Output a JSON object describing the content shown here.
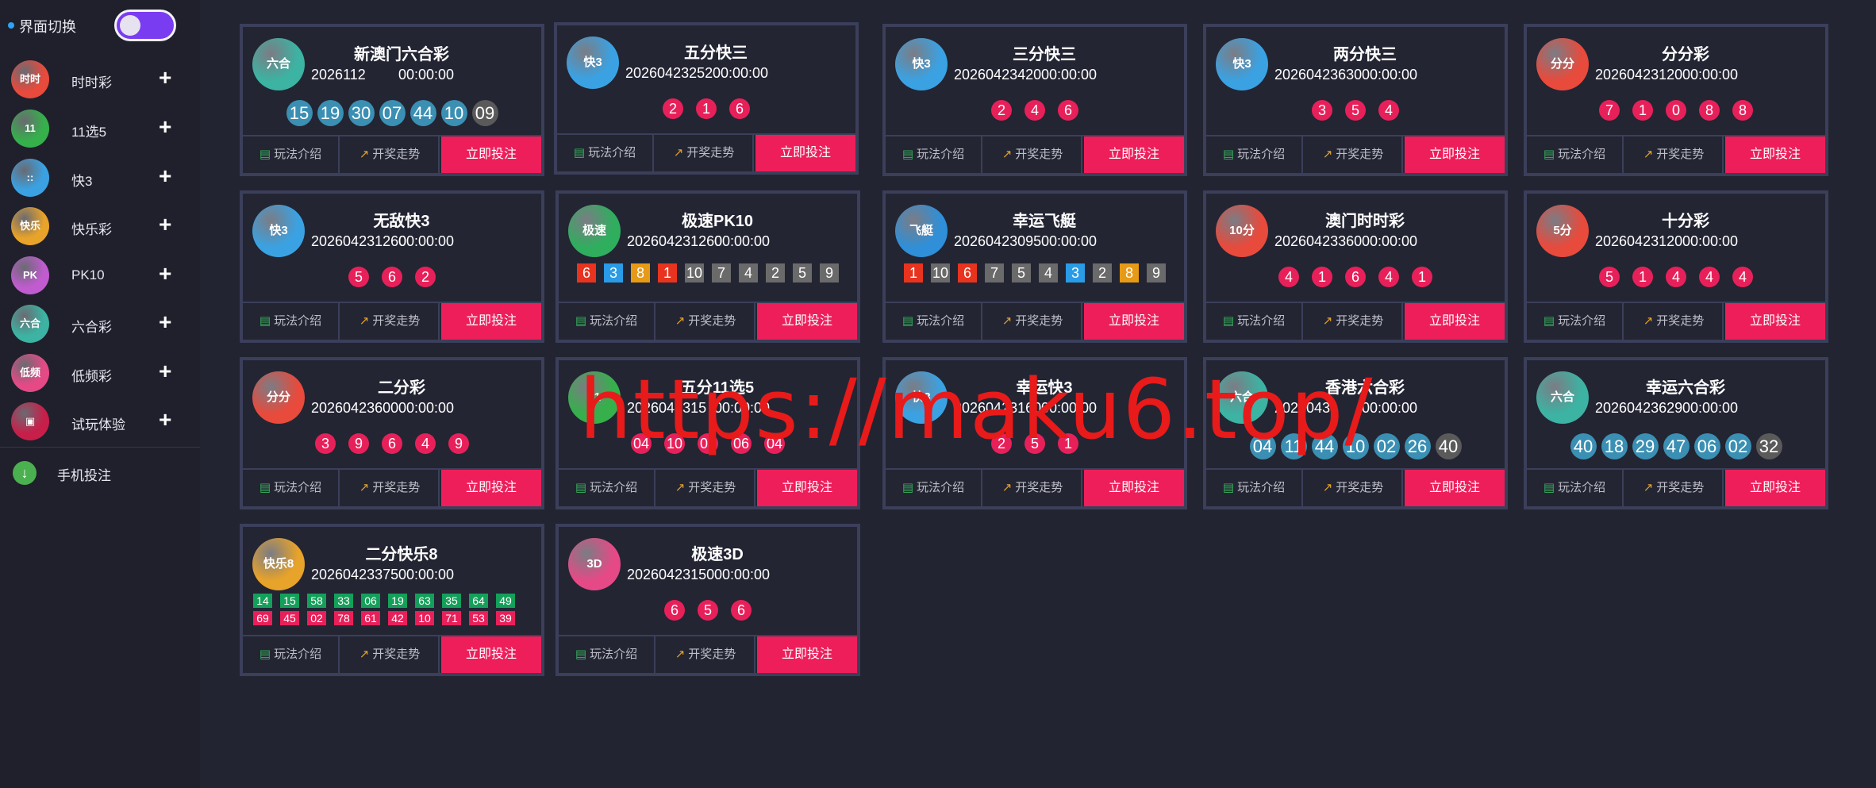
{
  "sidebar": {
    "switch_label": "界面切换",
    "items": [
      {
        "label": "时时彩",
        "icon_text": "时时",
        "icon_color": "#e84a3c"
      },
      {
        "label": "11选5",
        "icon_text": "11",
        "icon_color": "#35b04b"
      },
      {
        "label": "快3",
        "icon_text": "::",
        "icon_color": "#3aa2e3"
      },
      {
        "label": "快乐彩",
        "icon_text": "快乐",
        "icon_color": "#e8a32a"
      },
      {
        "label": "PK10",
        "icon_text": "PK",
        "icon_color": "#c05ccf"
      },
      {
        "label": "六合彩",
        "icon_text": "六合",
        "icon_color": "#3cb3a3"
      },
      {
        "label": "低频彩",
        "icon_text": "低频",
        "icon_color": "#e54a86"
      },
      {
        "label": "试玩体验",
        "icon_text": "▣",
        "icon_color": "#c81e4a"
      }
    ],
    "mobile_label": "手机投注"
  },
  "labels": {
    "rules": "玩法介绍",
    "trend": "开奖走势",
    "bet": "立即投注"
  },
  "cards": [
    {
      "title": "新澳门六合彩",
      "period": "2026112",
      "countdown": "00:00:00",
      "icon_text": "六合",
      "icon_color": "#3cb3a3",
      "type": "blue",
      "balls": [
        "15",
        "19",
        "30",
        "07",
        "44",
        "10",
        "09"
      ]
    },
    {
      "title": "五分快三",
      "period": "20260423252",
      "countdown": "00:00:00",
      "icon_text": "快3",
      "icon_color": "#3aa2e3",
      "type": "red",
      "balls": [
        "2",
        "1",
        "6"
      ]
    },
    {
      "title": "三分快三",
      "period": "20260423420",
      "countdown": "00:00:00",
      "icon_text": "快3",
      "icon_color": "#3aa2e3",
      "type": "red",
      "balls": [
        "2",
        "4",
        "6"
      ]
    },
    {
      "title": "两分快三",
      "period": "20260423630",
      "countdown": "00:00:00",
      "icon_text": "快3",
      "icon_color": "#3aa2e3",
      "type": "red",
      "balls": [
        "3",
        "5",
        "4"
      ]
    },
    {
      "title": "分分彩",
      "period": "20260423120",
      "countdown": "00:00:00",
      "icon_text": "分分",
      "icon_color": "#e84a3c",
      "type": "red",
      "balls": [
        "7",
        "1",
        "0",
        "8",
        "8"
      ]
    },
    {
      "title": "无敌快3",
      "period": "202604231260",
      "countdown": "00:00:00",
      "icon_text": "快3",
      "icon_color": "#3aa2e3",
      "type": "red",
      "balls": [
        "5",
        "6",
        "2"
      ]
    },
    {
      "title": "极速PK10",
      "period": "202604231260",
      "countdown": "00:00:00",
      "icon_text": "极速",
      "icon_color": "#2fae5e",
      "type": "pk",
      "balls": [
        "6",
        "3",
        "8",
        "1",
        "10",
        "7",
        "4",
        "2",
        "5",
        "9"
      ]
    },
    {
      "title": "幸运飞艇",
      "period": "20260423095",
      "countdown": "00:00:00",
      "icon_text": "飞艇",
      "icon_color": "#2f8fd8",
      "type": "pk",
      "balls": [
        "1",
        "10",
        "6",
        "7",
        "5",
        "4",
        "3",
        "2",
        "8",
        "9"
      ]
    },
    {
      "title": "澳门时时彩",
      "period": "20260423360",
      "countdown": "00:00:00",
      "icon_text": "10分",
      "icon_color": "#e84a3c",
      "type": "red",
      "balls": [
        "4",
        "1",
        "6",
        "4",
        "1"
      ]
    },
    {
      "title": "十分彩",
      "period": "20260423120",
      "countdown": "00:00:00",
      "icon_text": "5分",
      "icon_color": "#e84a3c",
      "type": "red",
      "balls": [
        "5",
        "1",
        "4",
        "4",
        "4"
      ]
    },
    {
      "title": "二分彩",
      "period": "20260423600",
      "countdown": "00:00:00",
      "icon_text": "分分",
      "icon_color": "#e84a3c",
      "type": "red",
      "balls": [
        "3",
        "9",
        "6",
        "4",
        "9"
      ]
    },
    {
      "title": "五分11选5",
      "period": "2026042315",
      "countdown": "00:00:00",
      "icon_text": "11",
      "icon_color": "#35b04b",
      "type": "red",
      "balls": [
        "04",
        "10",
        "03",
        "06",
        "04"
      ]
    },
    {
      "title": "幸运快3",
      "period": "20260423160",
      "countdown": "00:00:00",
      "icon_text": "快3",
      "icon_color": "#3aa2e3",
      "type": "red",
      "balls": [
        "2",
        "5",
        "1"
      ]
    },
    {
      "title": "香港六合彩",
      "period": "2026043",
      "countdown": "00:00:00",
      "icon_text": "六合",
      "icon_color": "#3cb3a3",
      "type": "blue",
      "balls": [
        "04",
        "11",
        "44",
        "10",
        "02",
        "26",
        "40"
      ]
    },
    {
      "title": "幸运六合彩",
      "period": "20260423629",
      "countdown": "00:00:00",
      "icon_text": "六合",
      "icon_color": "#3cb3a3",
      "type": "blue",
      "balls": [
        "40",
        "18",
        "29",
        "47",
        "06",
        "02",
        "32"
      ]
    },
    {
      "title": "二分快乐8",
      "period": "20260423375",
      "countdown": "00:00:00",
      "icon_text": "快乐8",
      "icon_color": "#e8a32a",
      "type": "kl8",
      "balls": [
        "14",
        "15",
        "58",
        "33",
        "06",
        "19",
        "63",
        "35",
        "64",
        "49",
        "69",
        "45",
        "02",
        "78",
        "61",
        "42",
        "10",
        "71",
        "53",
        "39"
      ]
    },
    {
      "title": "极速3D",
      "period": "20260423150",
      "countdown": "00:00:00",
      "icon_text": "3D",
      "icon_color": "#e54a86",
      "type": "red",
      "balls": [
        "6",
        "5",
        "6"
      ]
    }
  ],
  "pk_colors": {
    "1": "#e8341f",
    "2": "#6a6a6a",
    "3": "#2a9be6",
    "4": "#6a6a6a",
    "5": "#6a6a6a",
    "6": "#e8341f",
    "7": "#6a6a6a",
    "8": "#e69a16",
    "9": "#6a6a6a",
    "10": "#6a6a6a"
  },
  "watermark": "https://maku6.top/"
}
